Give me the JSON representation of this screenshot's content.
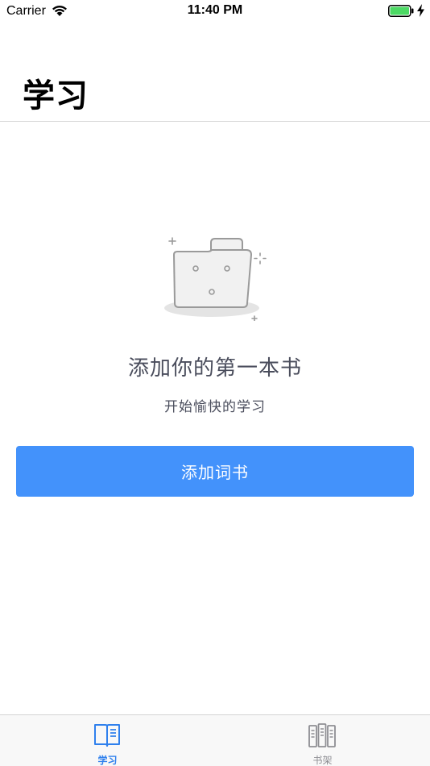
{
  "status_bar": {
    "carrier": "Carrier",
    "time": "11:40 PM",
    "battery_color": "#4cd964"
  },
  "header": {
    "title": "学习"
  },
  "empty_state": {
    "icon": "empty-folder-icon",
    "title": "添加你的第一本书",
    "subtitle": "开始愉快的学习"
  },
  "actions": {
    "add_book_label": "添加词书",
    "button_color": "#4392fb"
  },
  "tab_bar": {
    "tabs": [
      {
        "label": "学习",
        "icon": "open-book-icon",
        "active": true,
        "color": "#2f80ed"
      },
      {
        "label": "书架",
        "icon": "bookshelf-icon",
        "active": false,
        "color": "#8e8e93"
      }
    ]
  }
}
